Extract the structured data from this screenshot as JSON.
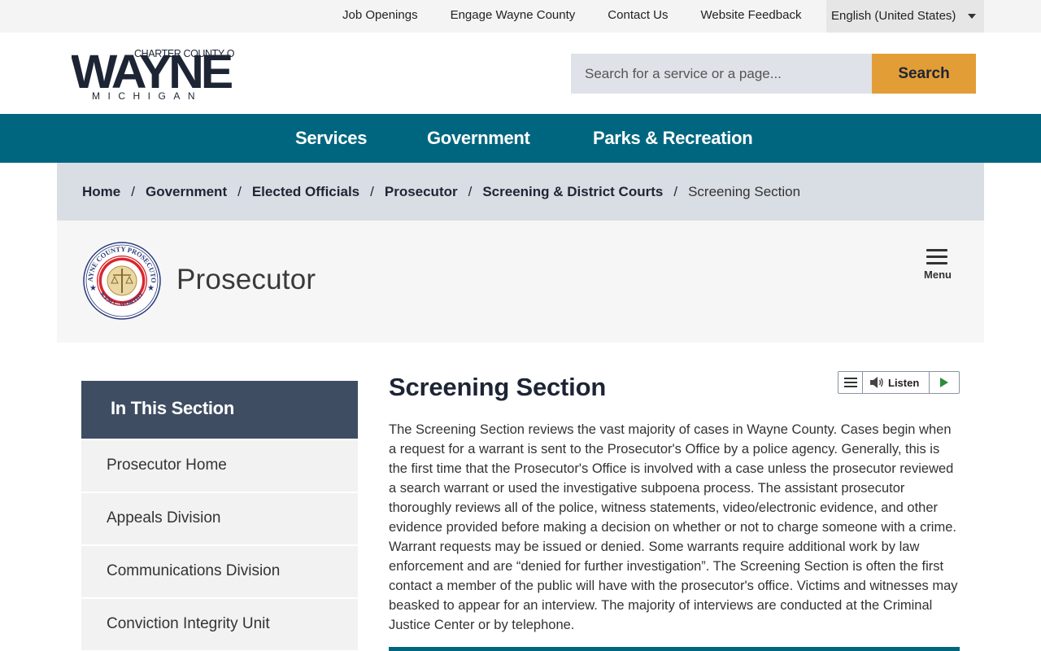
{
  "utility": {
    "links": [
      "Job Openings",
      "Engage Wayne County",
      "Contact Us",
      "Website Feedback"
    ],
    "language": "English (United States)"
  },
  "header": {
    "logo": {
      "line1": "CHARTER COUNTY OF",
      "line2": "WAYNE",
      "line3": "MICHIGAN"
    },
    "search_placeholder": "Search for a service or a page...",
    "search_button": "Search"
  },
  "nav": {
    "items": [
      "Services",
      "Government",
      "Parks & Recreation"
    ]
  },
  "breadcrumb": {
    "items": [
      "Home",
      "Government",
      "Elected Officials",
      "Prosecutor",
      "Screening & District Courts"
    ],
    "current": "Screening Section"
  },
  "department": {
    "title": "Prosecutor",
    "seal_top": "WAYNE COUNTY PROSECUTOR",
    "seal_bottom": "KYM L. WORTHY",
    "menu_label": "Menu"
  },
  "sidebar": {
    "header": "In This Section",
    "items": [
      "Prosecutor Home",
      "Appeals Division",
      "Communications Division",
      "Conviction Integrity Unit"
    ]
  },
  "content": {
    "heading": "Screening Section",
    "listen_label": "Listen",
    "body": "The Screening Section reviews the vast majority of cases in Wayne County. Cases begin when a request for a warrant is sent to the Prosecutor's Office by a police agency. Generally, this is the first time that the Prosecutor's Office is involved with a case unless the prosecutor reviewed a search warrant or used the investigative subpoena process. The assistant prosecutor thoroughly reviews all of the police, witness statements, video/electronic evidence, and other evidence provided before making a decision on whether or not to charge someone with a crime. Warrant requests may be issued or denied. Some warrants require additional work by law enforcement and are “denied for further investigation”. The Screening Section is often the first contact a member of the public will have with the prosecutor's office. Victims and witnesses may beasked to appear for an interview. The majority of interviews are conducted at the Criminal Justice Center or by telephone."
  },
  "colors": {
    "nav_teal": "#00667f",
    "search_orange": "#e39d37",
    "sidebar_header": "#3f4d63",
    "breadcrumb_bg": "#d9dde4",
    "logo_navy": "#1d2535"
  },
  "icons": [
    "chevron-down-icon",
    "hamburger-menu-icon",
    "speaker-icon",
    "play-icon",
    "prosecutor-seal"
  ]
}
